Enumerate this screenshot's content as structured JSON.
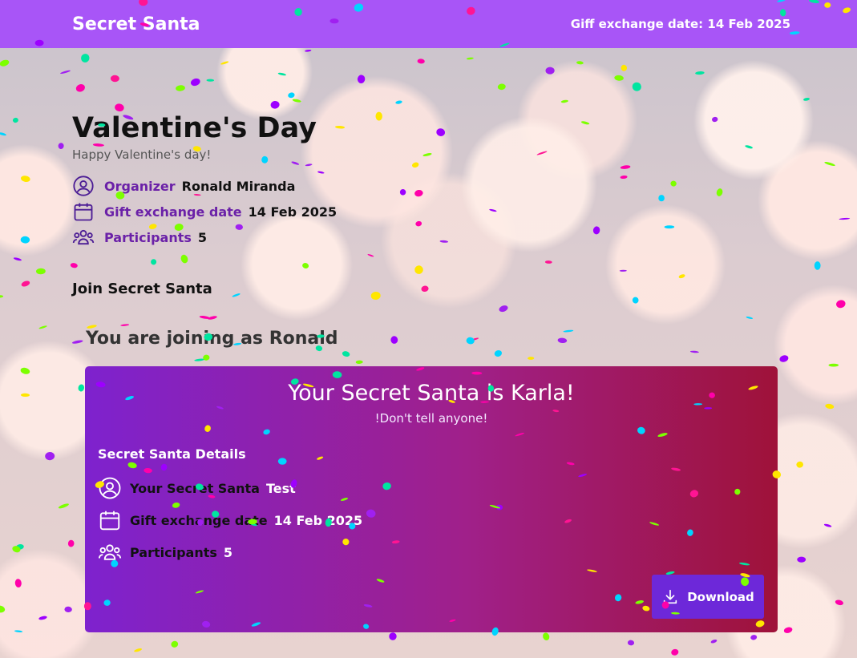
{
  "header": {
    "brand": "Secret Santa",
    "exchange_date_text": "Giff exchange date: 14 Feb 2025"
  },
  "event": {
    "title": "Valentine's Day",
    "subtitle": "Happy Valentine's day!",
    "info": [
      {
        "icon": "user-circle-icon",
        "label": "Organizer",
        "value": "Ronald Miranda"
      },
      {
        "icon": "calendar-icon",
        "label": "Gift exchange date",
        "value": "14 Feb 2025"
      },
      {
        "icon": "users-icon",
        "label": "Participants",
        "value": "5"
      }
    ]
  },
  "join": {
    "title": "Join Secret Santa",
    "joining_as": "You are joining as Ronald"
  },
  "result_card": {
    "title": "Your Secret Santa is Karla!",
    "subtitle": "!Don't tell anyone!",
    "details_title": "Secret Santa Details",
    "details": [
      {
        "icon": "user-circle-icon",
        "label": "Your Secret Santa",
        "value": "Test"
      },
      {
        "icon": "calendar-icon",
        "label": "Gift exchange date",
        "value": "14 Feb 2025"
      },
      {
        "icon": "users-icon",
        "label": "Participants",
        "value": "5"
      }
    ],
    "download_label": "Download",
    "download_icon": "download-icon"
  },
  "colors": {
    "header_bg": "#a855f7",
    "label_purple": "#6b21a8",
    "card_gradient_start": "#7e22ce",
    "card_gradient_end": "#9f1239",
    "button_bg": "#6d28d9"
  }
}
